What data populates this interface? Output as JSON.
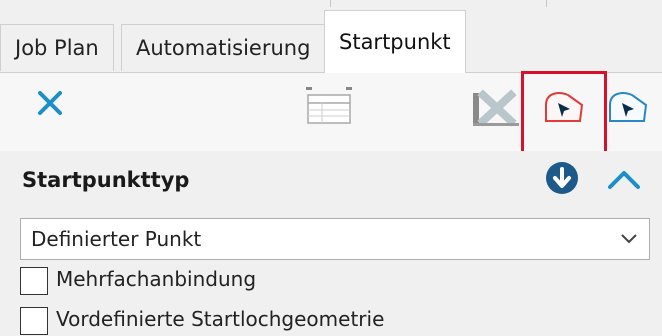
{
  "tabs": [
    {
      "label": "Job Plan"
    },
    {
      "label": "Automatisierung"
    },
    {
      "label": "Startpunkt",
      "active": true
    }
  ],
  "toolbar": {
    "icons": [
      "close-icon",
      "table-icon",
      "delete-x-icon",
      "startpoint-red-icon",
      "startpoint-blue-icon"
    ],
    "highlighted": "startpoint-red-icon"
  },
  "section": {
    "title": "Startpunkttyp",
    "info_icon": "down-arrow-circle-icon",
    "collapse_icon": "chevron-up-icon"
  },
  "dropdown": {
    "selected": "Definierter Punkt"
  },
  "checkboxes": [
    {
      "label": "Mehrfachanbindung",
      "checked": false
    },
    {
      "label": "Vordefinierte Startlochgeometrie",
      "checked": false
    }
  ],
  "colors": {
    "accent_blue": "#1a8fc8",
    "highlight_red": "#d6112b",
    "icon_red": "#e03a3a",
    "dark_blue": "#1d5a8c"
  }
}
